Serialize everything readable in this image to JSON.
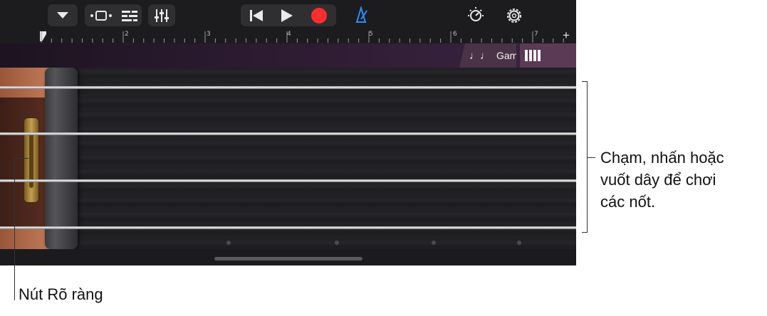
{
  "toolbar": {
    "buttons": [
      {
        "name": "browser-menu-button",
        "icon": "triangle-down-icon"
      },
      {
        "name": "track-view-button",
        "icon": "tracks-view-icon"
      },
      {
        "name": "smart-controls-button",
        "icon": "smart-controls-icon"
      },
      {
        "name": "mixer-button",
        "icon": "sliders-icon"
      },
      {
        "name": "go-to-beginning-button",
        "icon": "skip-back-icon"
      },
      {
        "name": "play-button",
        "icon": "play-icon"
      },
      {
        "name": "record-button",
        "icon": "record-icon"
      },
      {
        "name": "metronome-button",
        "icon": "metronome-icon"
      },
      {
        "name": "master-effects-button",
        "icon": "dial-icon"
      },
      {
        "name": "settings-button",
        "icon": "gear-icon"
      }
    ],
    "colors": {
      "record": "#ff2d2d",
      "metronome": "#2f8cff"
    }
  },
  "ruler": {
    "labels": [
      "2",
      "3",
      "4",
      "5",
      "6",
      "7"
    ],
    "add_symbol": "+"
  },
  "tabs": {
    "scale_label": "Gam",
    "scale_icon": "music-notes-icon",
    "notes_icon": "keyboard-keys-icon"
  },
  "callouts": {
    "strings_line1": "Chạm, nhấn hoặc",
    "strings_line2": "vuốt dây để chơi",
    "strings_line3": "các nốt.",
    "clear_button": "Nút Rõ ràng"
  }
}
